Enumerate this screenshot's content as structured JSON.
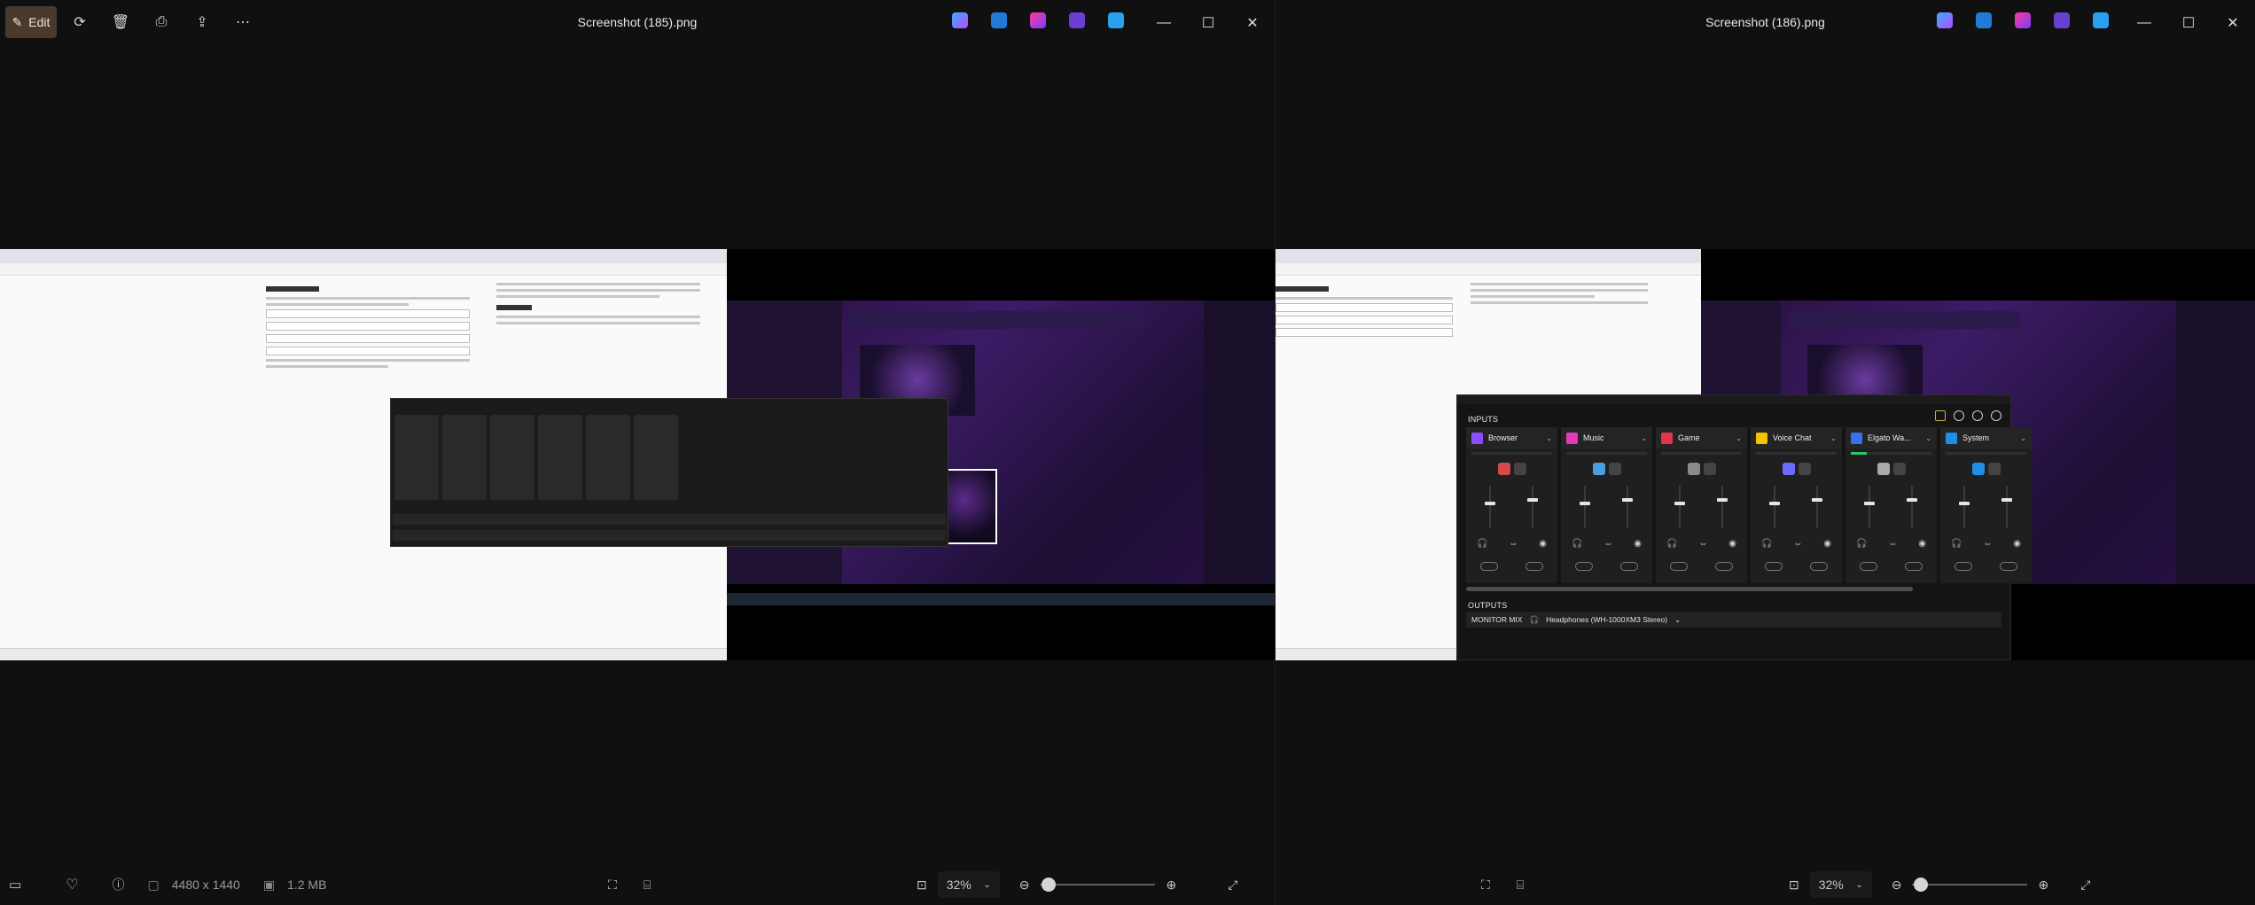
{
  "window_left": {
    "title": "Screenshot (185).png",
    "edit_label": "Edit",
    "info": {
      "dimensions": "4480 x 1440",
      "filesize": "1.2 MB"
    },
    "zoom": "32%"
  },
  "window_right": {
    "title": "Screenshot (186).png",
    "zoom": "32%"
  },
  "mixer": {
    "inputs_label": "INPUTS",
    "outputs_label": "OUTPUTS",
    "channels": [
      {
        "name": "Browser",
        "color": "#8a4dff",
        "meter": 0
      },
      {
        "name": "Music",
        "color": "#e23ab8",
        "meter": 0
      },
      {
        "name": "Game",
        "color": "#e3344a",
        "meter": 0
      },
      {
        "name": "Voice Chat",
        "color": "#f5c400",
        "meter": 0
      },
      {
        "name": "Elgato Wa...",
        "color": "#3a6ff0",
        "meter": 0.2
      },
      {
        "name": "System",
        "color": "#1d8fe6",
        "meter": 0
      }
    ],
    "output_mix": "MONITOR MIX",
    "output_device": "Headphones (WH-1000XM3 Stereo)"
  },
  "icons": [
    "edit-icon",
    "rotate-icon",
    "delete-icon",
    "print-icon",
    "share-icon",
    "more-icon",
    "minimize-icon",
    "maximize-icon",
    "close-icon",
    "filmstrip-icon",
    "favorite-icon",
    "info-icon",
    "zoom-out-icon",
    "zoom-in-icon",
    "fullscreen-icon"
  ]
}
